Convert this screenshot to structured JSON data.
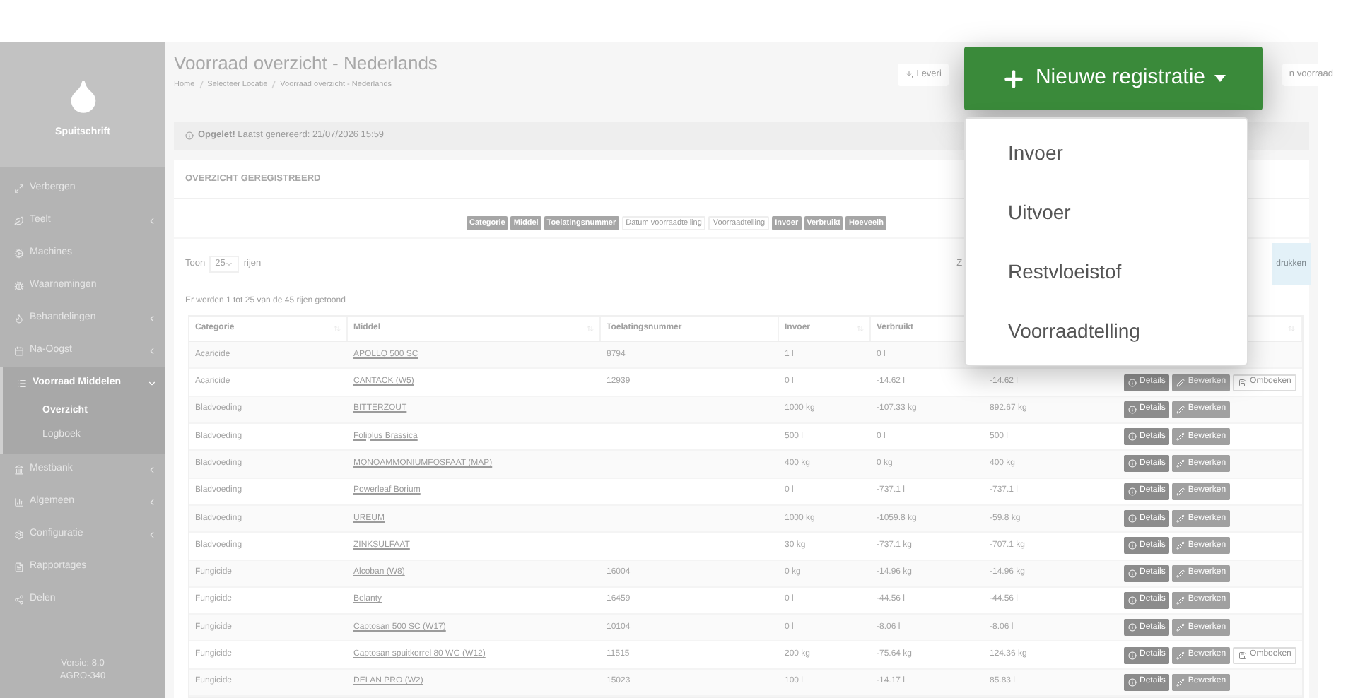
{
  "sidebar": {
    "brand": "Spuitschrift",
    "items": [
      {
        "label": "Verbergen",
        "expandable": false,
        "selected": false
      },
      {
        "label": "Teelt",
        "expandable": true,
        "expanded": false,
        "selected": false
      },
      {
        "label": "Machines",
        "expandable": false,
        "selected": false
      },
      {
        "label": "Waarnemingen",
        "expandable": false,
        "selected": false
      },
      {
        "label": "Behandelingen",
        "expandable": true,
        "expanded": false,
        "selected": false
      },
      {
        "label": "Na-Oogst",
        "expandable": true,
        "expanded": false,
        "selected": false
      },
      {
        "label": "Voorraad Middelen",
        "expandable": true,
        "expanded": true,
        "selected": true,
        "children": [
          {
            "label": "Overzicht",
            "selected": true
          },
          {
            "label": "Logboek",
            "selected": false
          }
        ]
      },
      {
        "label": "Mestbank",
        "expandable": true,
        "expanded": false,
        "selected": false
      },
      {
        "label": "Algemeen",
        "expandable": true,
        "expanded": false,
        "selected": false
      },
      {
        "label": "Configuratie",
        "expandable": true,
        "expanded": false,
        "selected": false
      },
      {
        "label": "Rapportages",
        "expandable": false,
        "selected": false
      },
      {
        "label": "Delen",
        "expandable": false,
        "selected": false
      }
    ],
    "version": "Versie: 8.0",
    "build": "AGRO-340"
  },
  "page": {
    "title": "Voorraad overzicht - Nederlands",
    "breadcrumb": [
      "Home",
      "Selecteer Locatie",
      "Voorraad overzicht - Nederlands"
    ],
    "toolbar_buttons": [
      {
        "label": "Leveri",
        "kind": "download"
      },
      {
        "label": "n voorraad",
        "kind": "plain"
      }
    ],
    "alert": "**Opgelet!** Laatst genereerd: 21/07/2026 15:59"
  },
  "card": {
    "title": "OVERZICHT GEREGISTREERD",
    "column_toggles": [
      {
        "label": "Categorie",
        "selected": true
      },
      {
        "label": "Middel",
        "selected": true
      },
      {
        "label": "Toelatingsnummer",
        "selected": true
      },
      {
        "label": "Datum voorraadtelling",
        "selected": false
      },
      {
        "label": "Voorraadtelling",
        "selected": false
      },
      {
        "label": "Invoer",
        "selected": true
      },
      {
        "label": "Verbruikt",
        "selected": true
      },
      {
        "label": "Hoeveelh",
        "selected": true
      }
    ],
    "page_size": {
      "before": "Toon",
      "value": "25",
      "after": "rijen"
    },
    "search_label": "Z",
    "print_label": "drukken",
    "info": "Er worden 1 tot 25 van de 45 rijen getoond",
    "table": {
      "columns": [
        "Categorie",
        "Middel",
        "Toelatingsnummer",
        "Invoer",
        "Verbruikt"
      ],
      "rows": [
        {
          "category": "Acaricide",
          "product": "APOLLO 500 SC",
          "authorization": "8794",
          "input": "1 l",
          "used": "0 l",
          "actions": []
        },
        {
          "category": "Acaricide",
          "product": "CANTACK (W5)",
          "authorization": "12939",
          "input": "0 l",
          "used": "-14.62 l",
          "column_6": "-14.62 l",
          "actions": [
            {
              "label": "Details",
              "kind": "details"
            },
            {
              "label": "Bewerken",
              "kind": "edit"
            },
            {
              "label": "Omboeken",
              "kind": "rebook"
            }
          ]
        },
        {
          "category": "Bladvoeding",
          "product": "BITTERZOUT",
          "input": "1000 kg",
          "used": "-107.33 kg",
          "column_6": "892.67 kg",
          "actions": [
            {
              "label": "Details",
              "kind": "details"
            },
            {
              "label": "Bewerken",
              "kind": "edit"
            }
          ]
        },
        {
          "category": "Bladvoeding",
          "product": "Foliplus Brassica",
          "input": "500 l",
          "used": "0 l",
          "column_6": "500 l",
          "actions": [
            {
              "label": "Details",
              "kind": "details"
            },
            {
              "label": "Bewerken",
              "kind": "edit"
            }
          ]
        },
        {
          "category": "Bladvoeding",
          "product": "MONOAMMONIUMFOSFAAT (MAP)",
          "input": "400 kg",
          "used": "0 kg",
          "column_6": "400 kg",
          "actions": [
            {
              "label": "Details",
              "kind": "details"
            },
            {
              "label": "Bewerken",
              "kind": "edit"
            }
          ]
        },
        {
          "category": "Bladvoeding",
          "product": "Powerleaf Borium",
          "input": "0 l",
          "used": "-737.1 l",
          "column_6": "-737.1 l",
          "actions": [
            {
              "label": "Details",
              "kind": "details"
            },
            {
              "label": "Bewerken",
              "kind": "edit"
            }
          ]
        },
        {
          "category": "Bladvoeding",
          "product": "UREUM",
          "input": "1000 kg",
          "used": "-1059.8 kg",
          "column_6": "-59.8 kg",
          "actions": [
            {
              "label": "Details",
              "kind": "details"
            },
            {
              "label": "Bewerken",
              "kind": "edit"
            }
          ]
        },
        {
          "category": "Bladvoeding",
          "product": "ZINKSULFAAT",
          "input": "30 kg",
          "used": "-737.1 kg",
          "column_6": "-707.1 kg",
          "actions": [
            {
              "label": "Details",
              "kind": "details"
            },
            {
              "label": "Bewerken",
              "kind": "edit"
            }
          ]
        },
        {
          "category": "Fungicide",
          "product": "Alcoban (W8)",
          "authorization": "16004",
          "input": "0 kg",
          "used": "-14.96 kg",
          "column_6": "-14.96 kg",
          "actions": [
            {
              "label": "Details",
              "kind": "details"
            },
            {
              "label": "Bewerken",
              "kind": "edit"
            }
          ]
        },
        {
          "category": "Fungicide",
          "product": "Belanty",
          "authorization": "16459",
          "input": "0 l",
          "used": "-44.56 l",
          "column_6": "-44.56 l",
          "actions": [
            {
              "label": "Details",
              "kind": "details"
            },
            {
              "label": "Bewerken",
              "kind": "edit"
            }
          ]
        },
        {
          "category": "Fungicide",
          "product": "Captosan 500 SC (W17)",
          "authorization": "10104",
          "input": "0 l",
          "used": "-8.06 l",
          "column_6": "-8.06 l",
          "actions": [
            {
              "label": "Details",
              "kind": "details"
            },
            {
              "label": "Bewerken",
              "kind": "edit"
            }
          ]
        },
        {
          "category": "Fungicide",
          "product": "Captosan spuitkorrel 80 WG (W12)",
          "authorization": "11515",
          "input": "200 kg",
          "used": "-75.64 kg",
          "column_6": "124.36 kg",
          "actions": [
            {
              "label": "Details",
              "kind": "details"
            },
            {
              "label": "Bewerken",
              "kind": "edit"
            },
            {
              "label": "Omboeken",
              "kind": "rebook"
            }
          ]
        },
        {
          "category": "Fungicide",
          "product": "DELAN PRO (W2)",
          "authorization": "15023",
          "input": "100 l",
          "used": "-14.17 l",
          "column_6": "85.83 l",
          "actions": [
            {
              "label": "Details",
              "kind": "details"
            },
            {
              "label": "Bewerken",
              "kind": "edit"
            }
          ]
        }
      ]
    }
  },
  "dropdown": {
    "button": "Nieuwe registratie",
    "items": [
      "Invoer",
      "Uitvoer",
      "Restvloeistof",
      "Voorraadtelling"
    ]
  }
}
